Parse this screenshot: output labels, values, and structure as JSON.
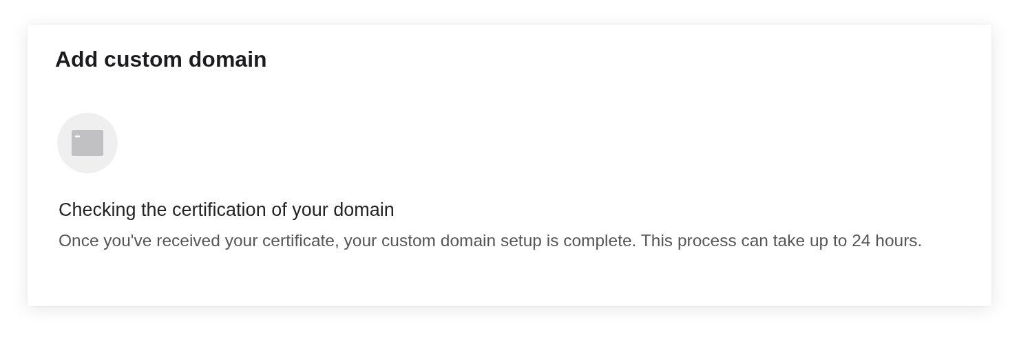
{
  "card": {
    "title": "Add custom domain",
    "status": {
      "heading": "Checking the certification of your domain",
      "description": "Once you've received your certificate, your custom domain setup is complete. This process can take up to 24 hours."
    }
  }
}
